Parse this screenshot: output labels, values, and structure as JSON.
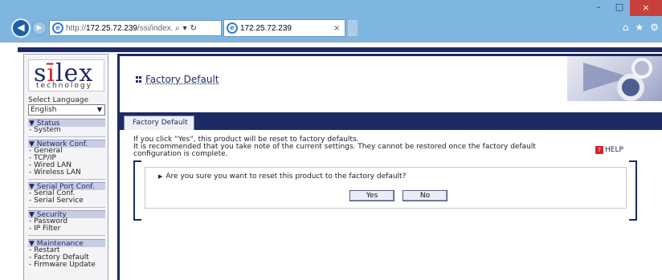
{
  "browser": {
    "url_prefix": "http://",
    "url_host": "172.25.72.239",
    "url_path": "/ssi/index.htm?paç",
    "search_glyph": "⌕",
    "dropdown_glyph": "▾",
    "refresh_glyph": "↻",
    "tab_title": "172.25.72.239",
    "tab_close": "×",
    "minimize": "–",
    "maximize": "□",
    "close": "×",
    "icons": [
      "home-icon",
      "favorites-icon",
      "settings-icon"
    ]
  },
  "sidebar": {
    "logo_main_pre": "s",
    "logo_main_dot": "ī",
    "logo_main_post": "lex",
    "logo_sub": "technology",
    "language_label": "Select Language",
    "language_value": "English",
    "sections": [
      {
        "title": "▼ Status",
        "items": [
          "- System"
        ]
      },
      {
        "title": "▼ Network Conf.",
        "items": [
          "- General",
          "- TCP/IP",
          "- Wired LAN",
          "- Wireless LAN"
        ]
      },
      {
        "title": "▼ Serial Port Conf.",
        "items": [
          "- Serial Conf.",
          "- Serial Service"
        ]
      },
      {
        "title": "▼ Security",
        "items": [
          "- Password",
          "- IP Filter"
        ]
      },
      {
        "title": "▼ Maintenance",
        "items": [
          "- Restart",
          "- Factory Default",
          "- Firmware Update"
        ]
      }
    ]
  },
  "main": {
    "page_title": "Factory Default",
    "tab_label": "Factory Default",
    "desc_line1": "If you click “Yes”, this product will be reset to factory defaults.",
    "desc_line2": "It is recommended that you take note of the current settings. They cannot be restored once the factory default",
    "desc_line3": "configuration is complete.",
    "help_label": "HELP",
    "question": "Are you sure you want to reset this product to the factory default?",
    "yes_label": "Yes",
    "no_label": "No"
  },
  "colors": {
    "accent": "#1e2a63",
    "brand_red": "#d8222a",
    "chrome": "#7fb6df"
  }
}
